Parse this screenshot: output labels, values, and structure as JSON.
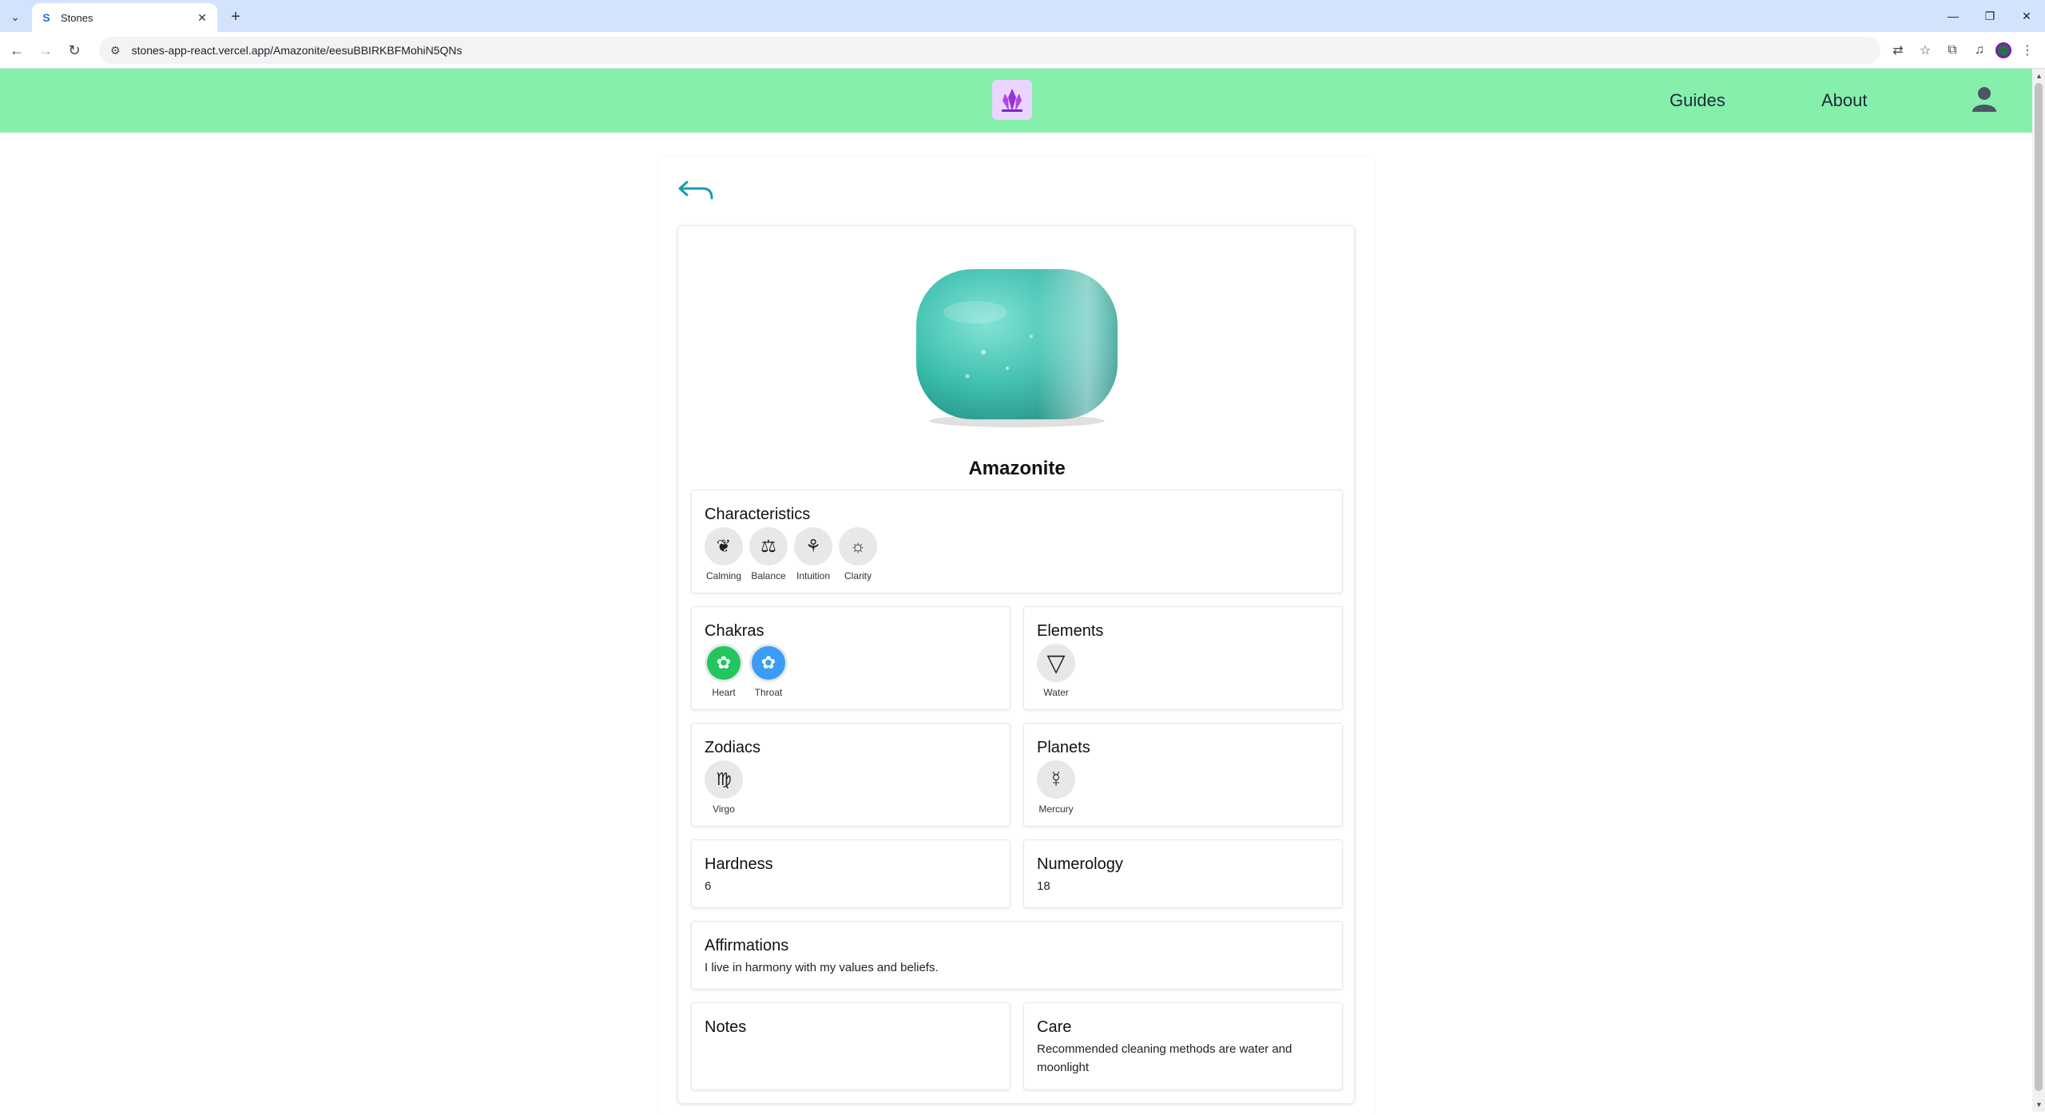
{
  "browser": {
    "tab_title": "Stones",
    "tab_favicon": "S",
    "url": "stones-app-react.vercel.app/Amazonite/eesuBBIRKBFMohiN5QNs"
  },
  "header": {
    "nav": [
      "Guides",
      "About"
    ]
  },
  "stone": {
    "name": "Amazonite",
    "image_color": "#4ccfbf"
  },
  "sections": {
    "characteristics": {
      "title": "Characteristics",
      "items": [
        {
          "label": "Calming",
          "icon": "lotus-icon",
          "glyph": "❦"
        },
        {
          "label": "Balance",
          "icon": "scales-icon",
          "glyph": "⚖"
        },
        {
          "label": "Intuition",
          "icon": "third-eye-icon",
          "glyph": "⚘"
        },
        {
          "label": "Clarity",
          "icon": "sun-icon",
          "glyph": "☼"
        }
      ]
    },
    "chakras": {
      "title": "Chakras",
      "items": [
        {
          "label": "Heart",
          "icon": "heart-chakra-icon",
          "glyph": "✿",
          "color": "#22c55e"
        },
        {
          "label": "Throat",
          "icon": "throat-chakra-icon",
          "glyph": "✿",
          "color": "#3b9cf5"
        }
      ]
    },
    "elements": {
      "title": "Elements",
      "items": [
        {
          "label": "Water",
          "icon": "water-triangle-icon",
          "glyph": "▽"
        }
      ]
    },
    "zodiacs": {
      "title": "Zodiacs",
      "items": [
        {
          "label": "Virgo",
          "icon": "virgo-icon",
          "glyph": "♍"
        }
      ]
    },
    "planets": {
      "title": "Planets",
      "items": [
        {
          "label": "Mercury",
          "icon": "mercury-icon",
          "glyph": "☿"
        }
      ]
    },
    "hardness": {
      "title": "Hardness",
      "value": "6"
    },
    "numerology": {
      "title": "Numerology",
      "value": "18"
    },
    "affirmations": {
      "title": "Affirmations",
      "value": "I live in harmony with my values and beliefs."
    },
    "notes": {
      "title": "Notes",
      "value": ""
    },
    "care": {
      "title": "Care",
      "value": "Recommended cleaning methods are water and moonlight"
    }
  },
  "colors": {
    "header_bg": "#86efac",
    "back_arrow": "#0e9fb4",
    "logo_bg": "#e9d5ff",
    "logo_crystal": "#9b30d9"
  }
}
